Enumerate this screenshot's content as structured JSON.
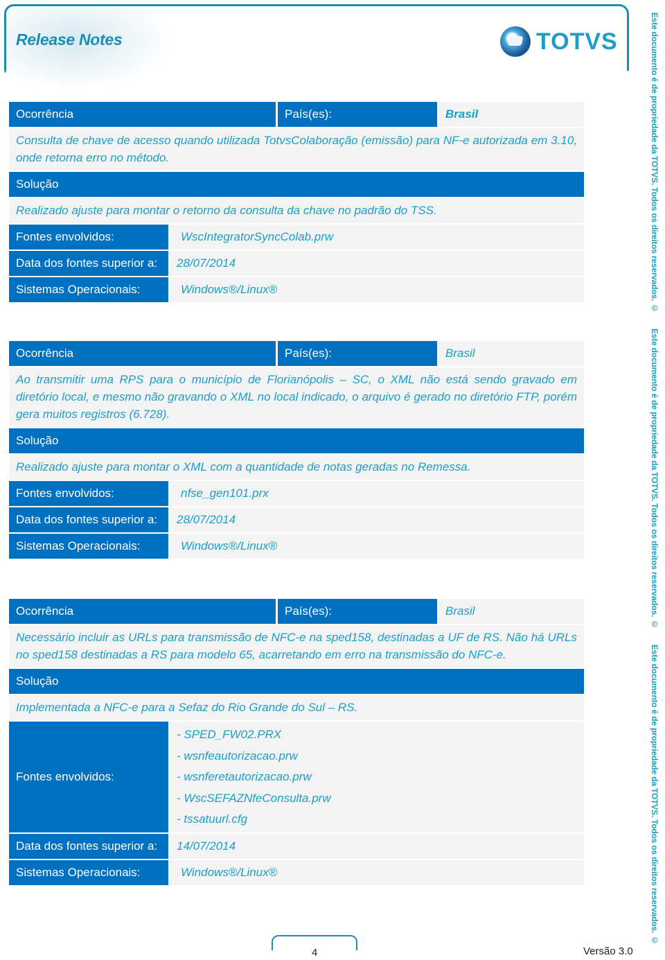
{
  "header": {
    "title": "Release Notes",
    "logo_text": "TOTVS"
  },
  "watermark": "Este documento é de propriedade da TOTVS. Todos os direitos reservados. ©",
  "labels": {
    "ocorrencia": "Ocorrência",
    "paises": "País(es):",
    "solucao": "Solução",
    "fontes": "Fontes envolvidos:",
    "data_fontes": "Data dos fontes superior a:",
    "sistemas": "Sistemas Operacionais:"
  },
  "entries": [
    {
      "country": "Brasil",
      "occurrence": "Consulta de chave de acesso quando utilizada TotvsColaboração (emissão) para NF-e autorizada em 3.10, onde retorna erro no método.",
      "solution": "Realizado ajuste para montar o retorno da consulta da chave no padrão do TSS.",
      "files": [
        "WscIntegratorSyncColab.prw"
      ],
      "date": "28/07/2014",
      "os": "Windows®/Linux®"
    },
    {
      "country": "Brasil",
      "occurrence": "Ao transmitir uma RPS para o município de Florianópolis – SC, o XML não está sendo gravado em diretório local, e mesmo não gravando o XML no local indicado, o arquivo é gerado no diretório FTP, porém gera muitos registros (6.728).",
      "solution": "Realizado ajuste para montar o XML com a quantidade de notas geradas no Remessa.",
      "files": [
        "nfse_gen101.prx"
      ],
      "date": "28/07/2014",
      "os": "Windows®/Linux®"
    },
    {
      "country": "Brasil",
      "occurrence": "Necessário incluir as URLs para transmissão de NFC-e na sped158, destinadas a UF de RS. Não há URLs no sped158 destinadas a RS para modelo 65, acarretando em erro na transmissão do NFC-e.",
      "solution": "Implementada a NFC-e para a Sefaz do Rio Grande do Sul – RS.",
      "files": [
        "- SPED_FW02.PRX",
        "- wsnfeautorizacao.prw",
        "- wsnferetautorizacao.prw",
        "- WscSEFAZNfeConsulta.prw",
        "- tssatuurl.cfg"
      ],
      "date": "14/07/2014",
      "os": "Windows®/Linux®"
    }
  ],
  "footer": {
    "page_number": "4",
    "version": "Versão 3.0"
  }
}
